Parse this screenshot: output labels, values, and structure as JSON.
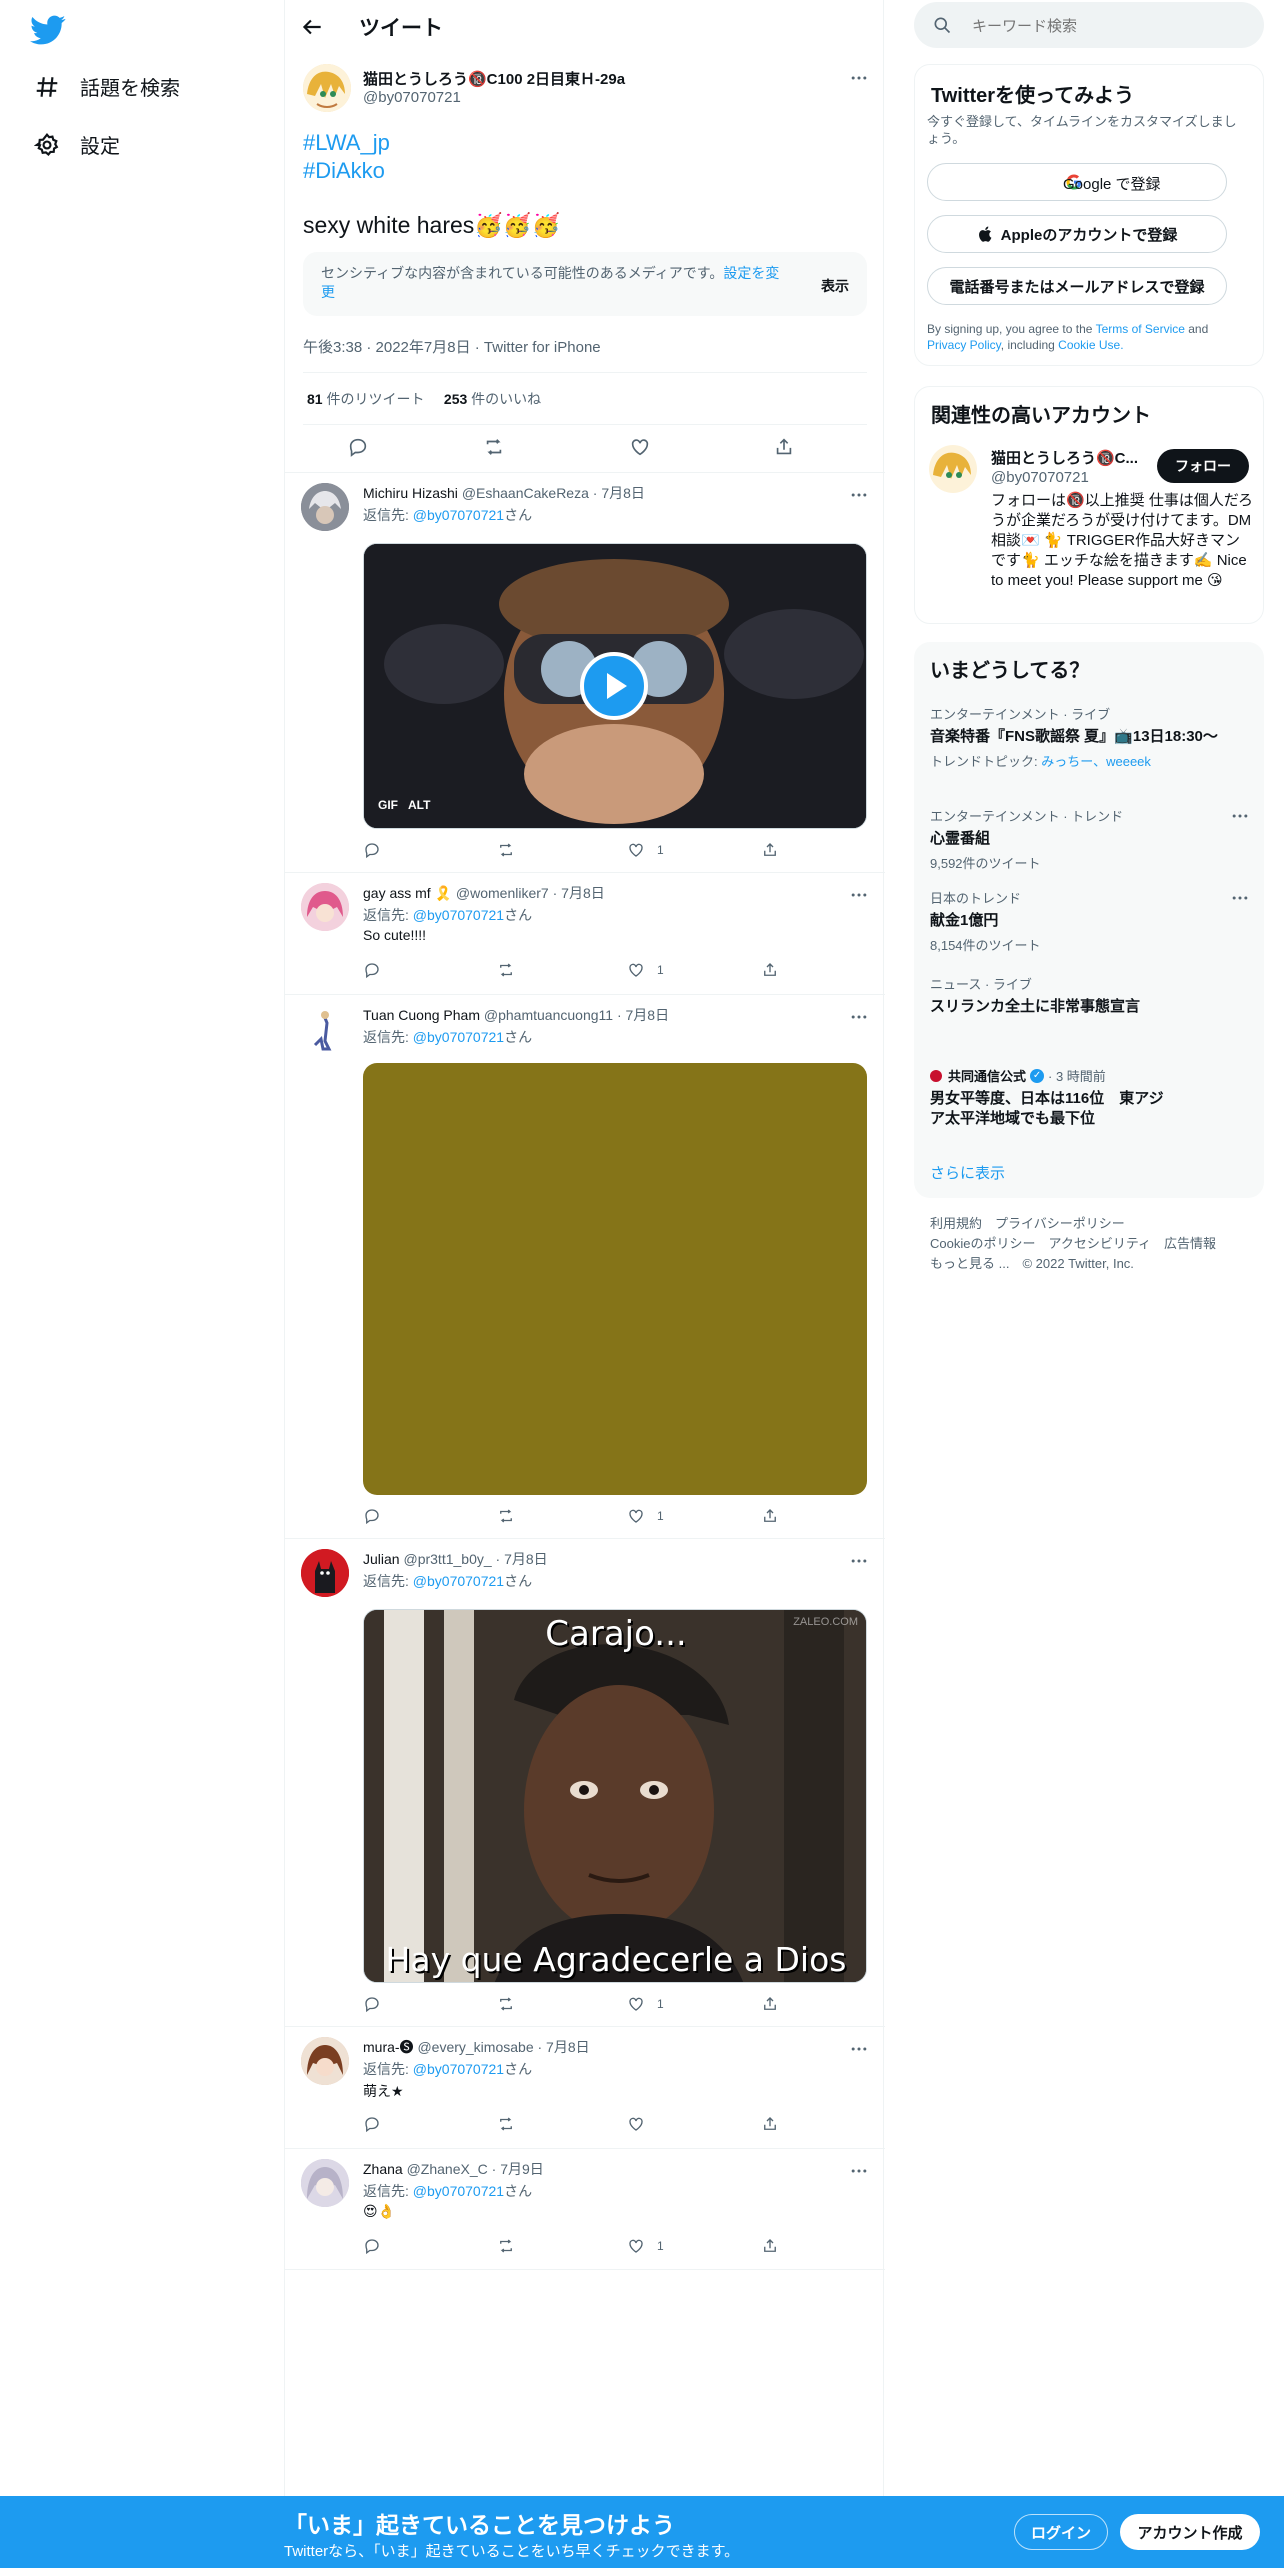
{
  "nav": {
    "items": [
      {
        "label": "話題を検索",
        "icon": "hashtag-icon"
      },
      {
        "label": "設定",
        "icon": "gear-icon"
      }
    ]
  },
  "header": {
    "title": "ツイート"
  },
  "tweet": {
    "author_name": "猫田とうしろう🔞C100 2日目東Ｈ-29a",
    "author_handle": "@by07070721",
    "hashtags": [
      "#LWA_jp",
      "#DiAkko"
    ],
    "text": "sexy white hares🥳🥳🥳",
    "sensitive_text": "センシティブな内容が含まれている可能性のあるメディアです。",
    "sensitive_link": "設定を変更",
    "sensitive_show": "表示",
    "timestamp": "午後3:38 · 2022年7月8日 · Twitter for iPhone",
    "retweets": "81",
    "retweets_label": " 件のリツイート",
    "likes": "253",
    "likes_label": " 件のいいね"
  },
  "reply_to_label": "返信先: ",
  "reply_to_handle": "@by07070721",
  "reply_to_suffix": "さん",
  "replies": [
    {
      "name": "Michiru Hizashi",
      "handle": "@EshaanCakeReza",
      "date": "· 7月8日",
      "text": "",
      "likes": "1",
      "media_badge_gif": "GIF",
      "media_badge_alt": "ALT"
    },
    {
      "name": "gay ass mf 🎗️",
      "handle": "@womenliker7",
      "date": "· 7月8日",
      "text": "So cute!!!!",
      "likes": "1"
    },
    {
      "name": "Tuan Cuong Pham",
      "handle": "@phamtuancuong11",
      "date": "· 7月8日",
      "text": "",
      "likes": "1"
    },
    {
      "name": "Julian",
      "handle": "@pr3tt1_b0y_",
      "date": "· 7月8日",
      "text": "",
      "likes": "1",
      "meme_top": "Carajo...",
      "meme_bottom": "Hay que Agradecerle a Dios",
      "meme_watermark": "ZALEO.COM"
    },
    {
      "name": "mura-🅢",
      "handle": "@every_kimosabe",
      "date": "· 7月8日",
      "text": "萌え★",
      "likes": ""
    },
    {
      "name": "Zhana",
      "handle": "@ZhaneX_C",
      "date": "· 7月9日",
      "text": "😍👌",
      "likes": "1"
    }
  ],
  "search": {
    "placeholder": "キーワード検索"
  },
  "signup_card": {
    "title": "Twitterを使ってみよう",
    "subtitle": "今すぐ登録して、タイムラインをカスタマイズしましょう。",
    "google": "Google で登録",
    "apple": "Appleのアカウントで登録",
    "phone": "電話番号またはメールアドレスで登録",
    "terms_pre": "By signing up, you agree to the ",
    "terms": "Terms of Service",
    "terms_and": " and ",
    "privacy": "Privacy Policy",
    "including": ", including ",
    "cookie": "Cookie Use."
  },
  "relevant": {
    "title": "関連性の高いアカウント",
    "name": "猫田とうしろう🔞C...",
    "handle": "@by07070721",
    "follow": "フォロー",
    "bio": "フォローは🔞以上推奨 仕事は個人だろうが企業だろうが受け付けてます。DM相談💌 🐈 TRIGGER作品大好きマンです🐈 エッチな絵を描きます✍️ Nice to meet you! Please support me 😘"
  },
  "trends": {
    "title": "いまどうしてる？",
    "items": [
      {
        "category": "エンターテインメント · ライブ",
        "name": "音楽特番『FNS歌謡祭 夏』📺13日18:30～",
        "sub_label": "トレンドトピック: ",
        "sub_links": "みっちー、weeeek"
      },
      {
        "category": "エンターテインメント · トレンド",
        "name": "心霊番組",
        "count": "9,592件のツイート"
      },
      {
        "category": "日本のトレンド",
        "name": "献金1億円",
        "count": "8,154件のツイート"
      },
      {
        "category": "ニュース · ライブ",
        "name": "スリランカ全土に非常事態宣言"
      },
      {
        "source": "共同通信公式",
        "time": "· 3 時間前",
        "name": "男女平等度、日本は116位　東アジア太平洋地域でも最下位"
      }
    ],
    "show_more": "さらに表示"
  },
  "footer": {
    "line1": "利用規約　プライバシーポリシー",
    "line2": "Cookieのポリシー　アクセシビリティ　広告情報",
    "line3": "もっと見る ...　© 2022 Twitter, Inc."
  },
  "banner": {
    "title": "「いま」起きていることを見つけよう",
    "subtitle": "Twitterなら、「いま」起きていることをいち早くチェックできます。",
    "login": "ログイン",
    "signup": "アカウント作成"
  },
  "colors": {
    "accent": "#1d9bf0",
    "text": "#0f1419",
    "muted": "#536471",
    "olive": "#857418"
  }
}
